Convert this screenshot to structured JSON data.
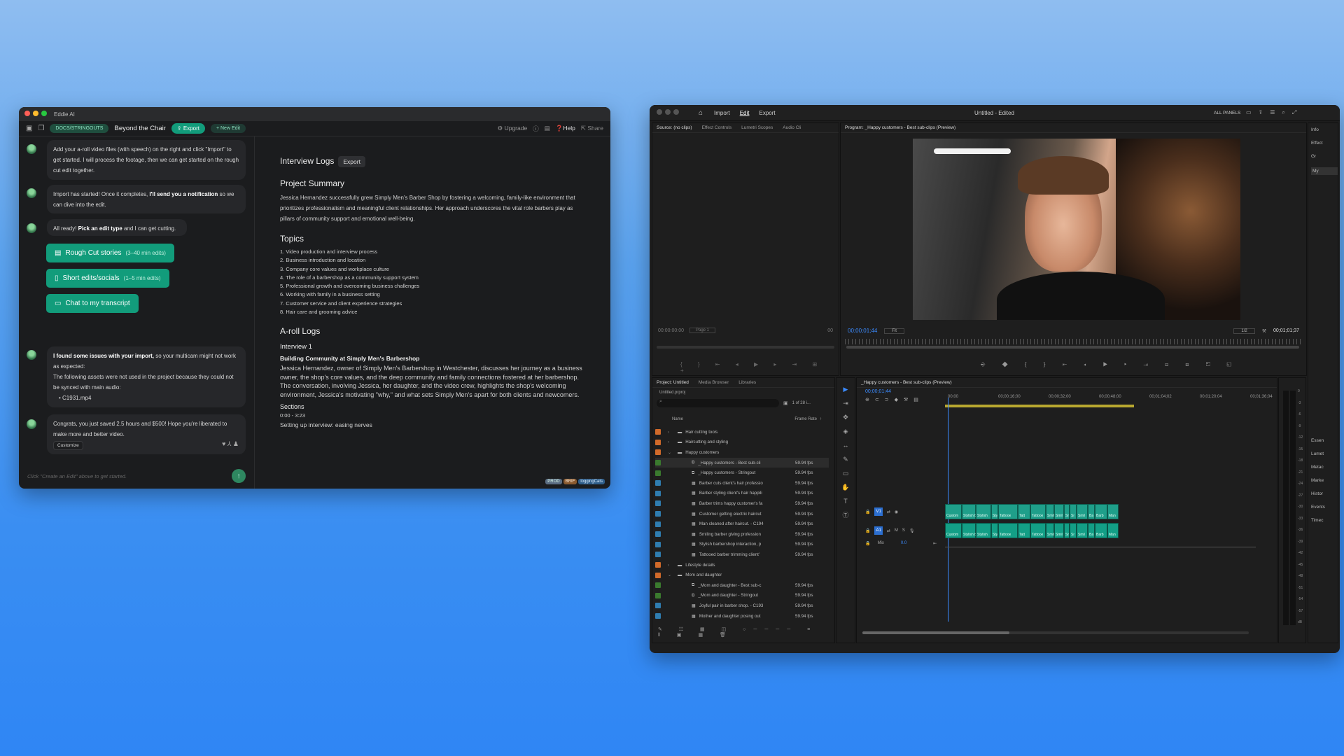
{
  "eddie": {
    "window_title": "Eddie AI",
    "toolbar": {
      "docs_pill": "DOCS/STRINGOUTS",
      "project_name": "Beyond the Chair",
      "export": "Export",
      "new_edit": "+ New Edit",
      "upgrade": "Upgrade",
      "help": "Help",
      "share": "Share"
    },
    "messages": {
      "m1": "Add your a-roll video files (with speech) on the right and click \"Import\" to get started. I will process the footage, then we can get started on the rough cut edit together.",
      "m2_a": "Import has started! Once it completes, ",
      "m2_b": "I'll send you a notification",
      "m2_c": " so we can dive into the edit.",
      "m3_a": "All ready! ",
      "m3_b": "Pick an edit type",
      "m3_c": " and I can get cutting.",
      "m4_a": "I found some issues with your import,",
      "m4_b": " so your multicam might not work as expected:",
      "m4_c": "The following assets were not used in the project because they could not be synced with main audio:",
      "m4_d": "C1931.mp4",
      "m5": "Congrats, you just saved 2.5 hours and $500! Hope you're liberated to make more and better video.",
      "customize": "Customize"
    },
    "buttons": {
      "rough_cut": "Rough Cut stories",
      "rough_cut_sub": "(3–40 min edits)",
      "short_edits": "Short edits/socials",
      "short_edits_sub": "(1–5 min edits)",
      "chat": "Chat to my transcript"
    },
    "input_placeholder": "Click \"Create an Edit\" above to get started.",
    "doc": {
      "heading": "Interview Logs",
      "export": "Export",
      "summary_h": "Project Summary",
      "summary": "Jessica Hernandez successfully grew Simply Men's Barber Shop by fostering a welcoming, family-like environment that prioritizes professionalism and meaningful client relationships. Her approach underscores the vital role barbers play as pillars of community support and emotional well-being.",
      "topics_h": "Topics",
      "topics": [
        "1. Video production and interview process",
        "2. Business introduction and location",
        "3. Company core values and workplace culture",
        "4. The role of a barbershop as a community support system",
        "5. Professional growth and overcoming business challenges",
        "6. Working with family in a business setting",
        "7. Customer service and client experience strategies",
        "8. Hair care and grooming advice"
      ],
      "aroll_h": "A-roll Logs",
      "interview_h": "Interview 1",
      "interview_sub": "Building Community at Simply Men's Barbershop",
      "interview_body": "Jessica Hernandez, owner of Simply Men's Barbershop in Westchester, discusses her journey as a business owner, the shop's core values, and the deep community and family connections fostered at her barbershop. The conversation, involving Jessica, her daughter, and the video crew, highlights the shop's welcoming environment, Jessica's motivating \"why,\" and what sets Simply Men's apart for both clients and newcomers.",
      "sections_h": "Sections",
      "section_time": "0:00 - 3:23",
      "section_title": "Setting up interview: easing nerves",
      "tags": [
        "PROD",
        "BRIF",
        "loggingCats"
      ]
    }
  },
  "premiere": {
    "menu": {
      "import": "Import",
      "edit": "Edit",
      "export": "Export",
      "title": "Untitled - Edited",
      "all_panels": "ALL PANELS"
    },
    "source": {
      "tabs": [
        "Source: (no clips)",
        "Effect Controls",
        "Lumetri Scopes",
        "Audio Cli"
      ],
      "timecode": "00:00:00:00",
      "page": "Page 1",
      "tc_right": "00"
    },
    "program": {
      "tab": "Program: _Happy customers - Best sub-clips (Preview)",
      "timecode": "00;00;01;44",
      "fit": "Fit",
      "res": "1/2",
      "duration": "00;01;01;37"
    },
    "project": {
      "tabs": [
        "Project: Untitled",
        "Media Browser",
        "Libraries"
      ],
      "file": "Untitled.prproj",
      "count": "1 of 28 i...",
      "col_name": "Name",
      "col_rate": "Frame Rate",
      "rows": [
        {
          "name": "Hair cutting tools",
          "rate": "",
          "color": "#d16a2a",
          "kind": "folder",
          "depth": 1
        },
        {
          "name": "Haircutting and styling",
          "rate": "",
          "color": "#d16a2a",
          "kind": "folder",
          "depth": 1
        },
        {
          "name": "Happy customers",
          "rate": "",
          "color": "#d16a2a",
          "kind": "folder-open",
          "depth": 1
        },
        {
          "name": "_Happy customers - Best sub-cli",
          "rate": "59.94 fps",
          "color": "#3a7a2e",
          "kind": "seq",
          "depth": 2
        },
        {
          "name": "_Happy customers - Stringout",
          "rate": "59.94 fps",
          "color": "#3a7a2e",
          "kind": "seq",
          "depth": 2
        },
        {
          "name": "Barber cuts client's hair professio",
          "rate": "59.94 fps",
          "color": "#2f7db0",
          "kind": "clip",
          "depth": 2
        },
        {
          "name": "Barber styling client's hair happili",
          "rate": "59.94 fps",
          "color": "#2f7db0",
          "kind": "clip",
          "depth": 2
        },
        {
          "name": "Barber trims happy customer's fa",
          "rate": "59.94 fps",
          "color": "#2f7db0",
          "kind": "clip",
          "depth": 2
        },
        {
          "name": "Customer getting electric haircut",
          "rate": "59.94 fps",
          "color": "#2f7db0",
          "kind": "clip",
          "depth": 2
        },
        {
          "name": "Man cleaned after haircut. - C194",
          "rate": "59.94 fps",
          "color": "#2f7db0",
          "kind": "clip",
          "depth": 2
        },
        {
          "name": "Smiling barber giving profession",
          "rate": "59.94 fps",
          "color": "#2f7db0",
          "kind": "clip",
          "depth": 2
        },
        {
          "name": "Stylish barbershop interaction, p",
          "rate": "59.94 fps",
          "color": "#2f7db0",
          "kind": "clip",
          "depth": 2
        },
        {
          "name": "Tattooed barber trimming client'",
          "rate": "59.94 fps",
          "color": "#2f7db0",
          "kind": "clip",
          "depth": 2
        },
        {
          "name": "Lifestyle details",
          "rate": "",
          "color": "#d16a2a",
          "kind": "folder",
          "depth": 1
        },
        {
          "name": "Mom and daughter",
          "rate": "",
          "color": "#d16a2a",
          "kind": "folder-open",
          "depth": 1
        },
        {
          "name": "_Mom and daughter - Best sub-c",
          "rate": "59.94 fps",
          "color": "#3a7a2e",
          "kind": "seq",
          "depth": 2
        },
        {
          "name": "_Mom and daughter - Stringout",
          "rate": "59.94 fps",
          "color": "#3a7a2e",
          "kind": "seq",
          "depth": 2
        },
        {
          "name": "Joyful pair in barber shop. - C193",
          "rate": "59.94 fps",
          "color": "#2f7db0",
          "kind": "clip",
          "depth": 2
        },
        {
          "name": "Mother and daughter posing out",
          "rate": "59.94 fps",
          "color": "#2f7db0",
          "kind": "clip",
          "depth": 2
        }
      ]
    },
    "timeline": {
      "tab": "_Happy customers - Best sub-clips (Preview)",
      "timecode": "00;00;01;44",
      "ruler": [
        "00;00",
        "00;00;16;00",
        "00;00;32;00",
        "00;00;48;00",
        "00;01;04;02",
        "00;01;20;04",
        "00;01;36;04"
      ],
      "v1": "V1",
      "a1": "A1",
      "mix": "Mix",
      "mix_val": "0.0",
      "clip_labels": [
        "Custom",
        "Stylish ba",
        "Stylish",
        "Sty",
        "Tattooe",
        "Tatt",
        "Tattooe",
        "Smil",
        "Smil",
        "Sr",
        "Sr",
        "Smil",
        "Ba",
        "Barb",
        "Man"
      ]
    },
    "meter_scale": [
      "0",
      "-3",
      "-6",
      "-9",
      "-12",
      "-15",
      "-18",
      "-21",
      "-24",
      "-27",
      "-30",
      "-33",
      "-36",
      "-39",
      "-42",
      "-45",
      "-48",
      "-51",
      "-54",
      "-57",
      "dB"
    ],
    "side_panels": [
      "Info",
      "Effect",
      "Gr",
      "My",
      "Essen",
      "Lumet",
      "Metac",
      "Marke",
      "Histor",
      "Events",
      "Timec"
    ]
  }
}
